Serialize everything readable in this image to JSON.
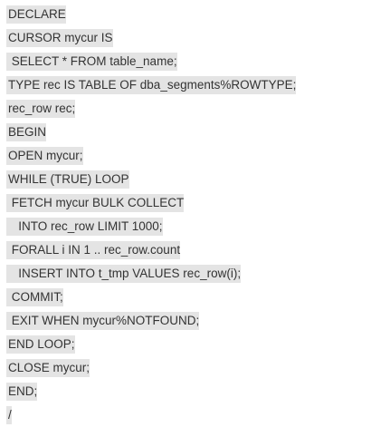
{
  "document": {
    "lines": [
      "DECLARE",
      "CURSOR mycur IS",
      " SELECT * FROM table_name;",
      "TYPE rec IS TABLE OF dba_segments%ROWTYPE;",
      "rec_row rec;",
      "BEGIN",
      "OPEN mycur;",
      "WHILE (TRUE) LOOP",
      " FETCH mycur BULK COLLECT",
      "   INTO rec_row LIMIT 1000;",
      " FORALL i IN 1 .. rec_row.count",
      "   INSERT INTO t_tmp VALUES rec_row(i);",
      " COMMIT;",
      " EXIT WHEN mycur%NOTFOUND;",
      "END LOOP;",
      "CLOSE mycur;",
      "END;",
      "/"
    ]
  }
}
